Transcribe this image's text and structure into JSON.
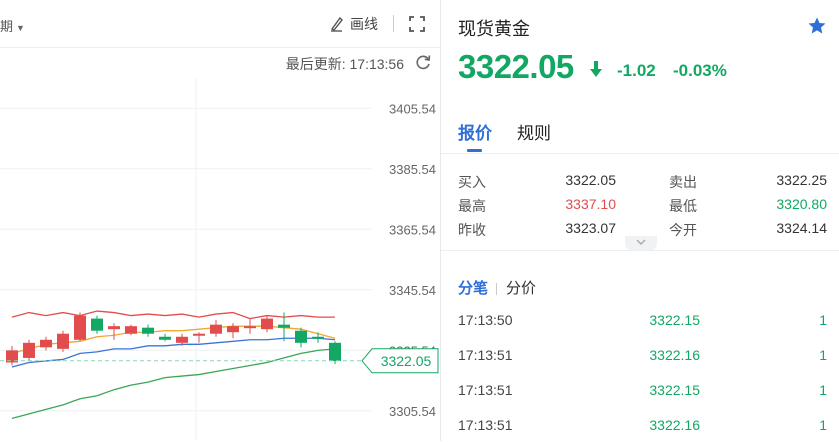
{
  "toolbar": {
    "period_partial": "期",
    "draw_label": "画线"
  },
  "update": {
    "text": "最后更新: 17:13:56"
  },
  "chart_data": {
    "type": "candlestick",
    "y_ticks": [
      "3405.54",
      "3385.54",
      "3365.54",
      "3345.54",
      "3325.54",
      "3305.54"
    ],
    "ylim": [
      3295.54,
      3415.54
    ],
    "current_price_label": "3322.05",
    "colors": {
      "up": "#e24c4c",
      "down": "#12a864"
    },
    "candles": [
      {
        "o": 3321.5,
        "c": 3325.5,
        "h": 3327.0,
        "l": 3320.5
      },
      {
        "o": 3323.0,
        "c": 3328.0,
        "h": 3329.0,
        "l": 3322.0
      },
      {
        "o": 3326.5,
        "c": 3329.0,
        "h": 3330.0,
        "l": 3325.5
      },
      {
        "o": 3326.0,
        "c": 3331.0,
        "h": 3332.0,
        "l": 3325.0
      },
      {
        "o": 3329.0,
        "c": 3337.0,
        "h": 3338.0,
        "l": 3328.5
      },
      {
        "o": 3336.0,
        "c": 3332.0,
        "h": 3337.0,
        "l": 3331.0
      },
      {
        "o": 3332.5,
        "c": 3333.5,
        "h": 3334.5,
        "l": 3329.0
      },
      {
        "o": 3331.0,
        "c": 3333.5,
        "h": 3334.0,
        "l": 3330.5
      },
      {
        "o": 3333.0,
        "c": 3331.0,
        "h": 3334.0,
        "l": 3330.0
      },
      {
        "o": 3330.0,
        "c": 3329.0,
        "h": 3331.0,
        "l": 3328.5
      },
      {
        "o": 3328.0,
        "c": 3330.0,
        "h": 3331.0,
        "l": 3327.0
      },
      {
        "o": 3330.5,
        "c": 3331.0,
        "h": 3331.5,
        "l": 3328.0
      },
      {
        "o": 3331.0,
        "c": 3334.0,
        "h": 3335.5,
        "l": 3330.0
      },
      {
        "o": 3331.5,
        "c": 3333.5,
        "h": 3334.5,
        "l": 3329.5
      },
      {
        "o": 3333.0,
        "c": 3333.5,
        "h": 3336.0,
        "l": 3331.0
      },
      {
        "o": 3332.5,
        "c": 3336.0,
        "h": 3337.0,
        "l": 3331.5
      },
      {
        "o": 3334.0,
        "c": 3333.0,
        "h": 3338.0,
        "l": 3328.5
      },
      {
        "o": 3332.0,
        "c": 3328.0,
        "h": 3333.0,
        "l": 3326.5
      },
      {
        "o": 3330.0,
        "c": 3329.5,
        "h": 3331.5,
        "l": 3328.0
      },
      {
        "o": 3328.0,
        "c": 3322.0,
        "h": 3328.5,
        "l": 3321.0
      }
    ],
    "upper_band": [
      3336.5,
      3338.0,
      3337.0,
      3338.0,
      3337.0,
      3338.5,
      3338.0,
      3337.0,
      3337.5,
      3337.0,
      3337.5,
      3336.5,
      3337.5,
      3338.0,
      3336.0,
      3337.0,
      3336.5,
      3337.0,
      3336.5,
      3336.5
    ],
    "middle_line": [
      3324.5,
      3326.0,
      3327.5,
      3328.0,
      3328.5,
      3330.0,
      3330.5,
      3331.5,
      3331.5,
      3332.0,
      3332.0,
      3332.5,
      3333.0,
      3333.5,
      3333.5,
      3333.5,
      3333.0,
      3332.5,
      3331.0,
      3329.5
    ],
    "ma_line": [
      3320.0,
      3321.5,
      3322.0,
      3322.5,
      3324.5,
      3325.0,
      3326.0,
      3326.0,
      3327.0,
      3327.0,
      3327.5,
      3327.5,
      3328.0,
      3328.5,
      3329.0,
      3329.0,
      3329.5,
      3329.5,
      3329.5,
      3329.0
    ],
    "lower_band": [
      3303.0,
      3304.5,
      3306.0,
      3307.5,
      3309.5,
      3310.5,
      3312.5,
      3314.0,
      3315.0,
      3316.5,
      3317.0,
      3317.5,
      3318.5,
      3319.5,
      3320.5,
      3321.5,
      3323.0,
      3324.5,
      3325.5,
      3326.0
    ]
  },
  "panel": {
    "title": "现货黄金",
    "price": "3322.05",
    "change": "-1.02",
    "change_pct": "-0.03%",
    "tabs": [
      "报价",
      "规则"
    ],
    "quote_rows": [
      {
        "l1": "买入",
        "v1": "3322.05",
        "l2": "卖出",
        "v2": "3322.25"
      },
      {
        "l1": "最高",
        "v1": "3337.10",
        "l2": "最低",
        "v2": "3320.80"
      },
      {
        "l1": "昨收",
        "v1": "3323.07",
        "l2": "今开",
        "v2": "3324.14"
      }
    ],
    "tick_tabs": [
      "分笔",
      "分价"
    ],
    "ticks": [
      {
        "time": "17:13:50",
        "price": "3322.15",
        "vol": "1"
      },
      {
        "time": "17:13:51",
        "price": "3322.16",
        "vol": "1"
      },
      {
        "time": "17:13:51",
        "price": "3322.15",
        "vol": "1"
      },
      {
        "time": "17:13:51",
        "price": "3322.16",
        "vol": "1"
      }
    ]
  }
}
